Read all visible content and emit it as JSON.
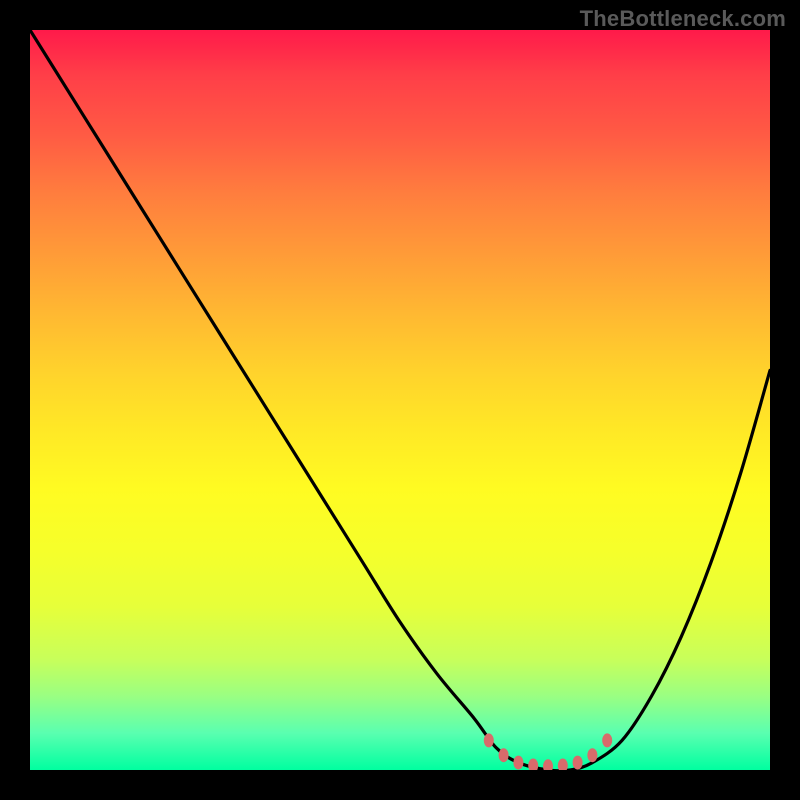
{
  "watermark": "TheBottleneck.com",
  "colors": {
    "background": "#000000",
    "curve": "#000000",
    "marker": "#d86b6b",
    "gradient_top": "#ff1a4a",
    "gradient_bottom": "#00ffa0"
  },
  "chart_data": {
    "type": "line",
    "title": "",
    "xlabel": "",
    "ylabel": "",
    "xlim": [
      0,
      100
    ],
    "ylim": [
      0,
      100
    ],
    "grid": false,
    "legend": false,
    "annotations": [
      "TheBottleneck.com"
    ],
    "series": [
      {
        "name": "bottleneck-curve",
        "x": [
          0,
          5,
          10,
          15,
          20,
          25,
          30,
          35,
          40,
          45,
          50,
          55,
          60,
          63,
          66,
          70,
          73,
          76,
          80,
          84,
          88,
          92,
          96,
          100
        ],
        "values": [
          100,
          92,
          84,
          76,
          68,
          60,
          52,
          44,
          36,
          28,
          20,
          13,
          7,
          3,
          1,
          0,
          0,
          1,
          4,
          10,
          18,
          28,
          40,
          54
        ]
      }
    ],
    "markers": [
      {
        "x": 62,
        "y": 4
      },
      {
        "x": 64,
        "y": 2
      },
      {
        "x": 66,
        "y": 1
      },
      {
        "x": 68,
        "y": 0.6
      },
      {
        "x": 70,
        "y": 0.5
      },
      {
        "x": 72,
        "y": 0.6
      },
      {
        "x": 74,
        "y": 1
      },
      {
        "x": 76,
        "y": 2
      },
      {
        "x": 78,
        "y": 4
      }
    ]
  }
}
